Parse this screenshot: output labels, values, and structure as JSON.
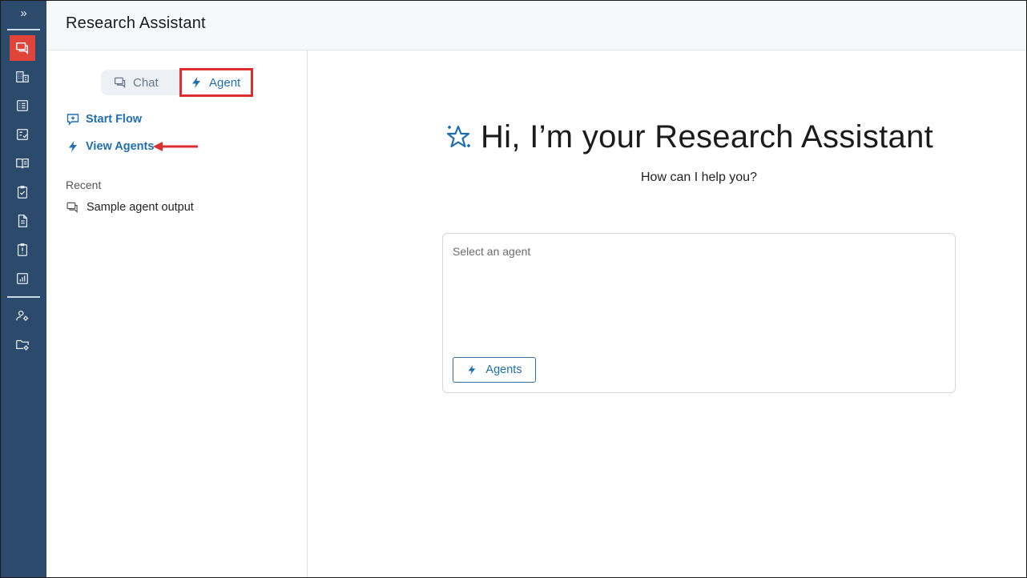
{
  "header": {
    "title": "Research Assistant"
  },
  "rail": {
    "expand_label": "»"
  },
  "panel": {
    "tabs": [
      {
        "label": "Chat"
      },
      {
        "label": "Agent"
      }
    ],
    "actions": {
      "start_flow": "Start Flow",
      "view_agents": "View Agents"
    },
    "recent_heading": "Recent",
    "recent_items": [
      "Sample agent output"
    ]
  },
  "main": {
    "greeting": "Hi, I’m your Research Assistant",
    "subtitle": "How can I help you?",
    "composer": {
      "placeholder": "Select an agent",
      "agents_button": "Agents"
    }
  },
  "colors": {
    "rail": "#2c4a6b",
    "accent": "#1f6fb0",
    "highlight": "#dc2e2e"
  }
}
